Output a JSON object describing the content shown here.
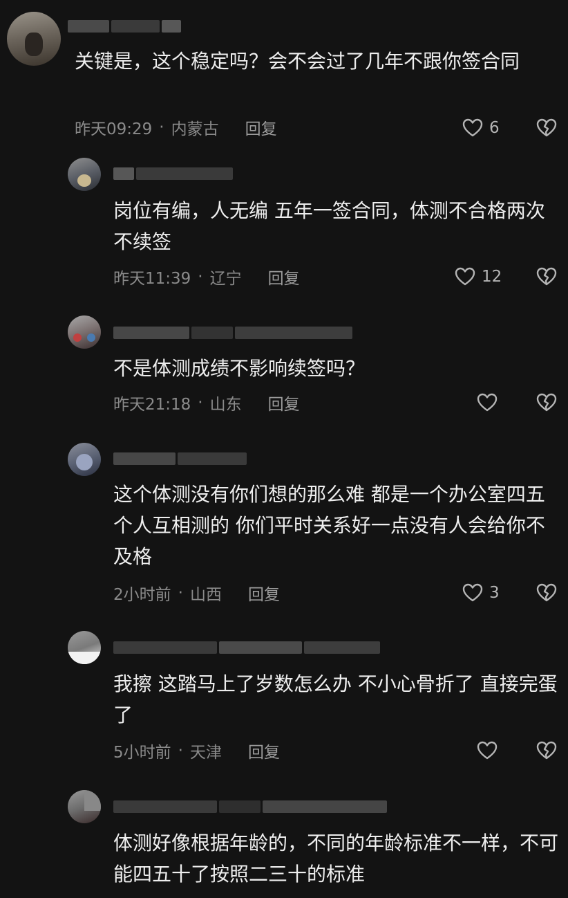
{
  "comments": [
    {
      "text": "关键是，这个稳定吗？会不会过了几年不跟你签合同",
      "time": "昨天09:29",
      "location": "内蒙古",
      "reply_label": "回复",
      "likes": "6"
    },
    {
      "text": "岗位有编，人无编 五年一签合同，体测不合格两次不续签",
      "time": "昨天11:39",
      "location": "辽宁",
      "reply_label": "回复",
      "likes": "12"
    },
    {
      "text": "不是体测成绩不影响续签吗？",
      "time": "昨天21:18",
      "location": "山东",
      "reply_label": "回复",
      "likes": ""
    },
    {
      "text": "这个体测没有你们想的那么难 都是一个办公室四五个人互相测的 你们平时关系好一点没有人会给你不及格",
      "time": "2小时前",
      "location": "山西",
      "reply_label": "回复",
      "likes": "3"
    },
    {
      "text": "我擦 这踏马上了岁数怎么办 不小心骨折了 直接完蛋了",
      "time": "5小时前",
      "location": "天津",
      "reply_label": "回复",
      "likes": ""
    },
    {
      "text": "体测好像根据年龄的，不同的年龄标准不一样，不可能四五十了按照二三十的标准",
      "time": "",
      "location": "",
      "reply_label": "",
      "likes": ""
    }
  ],
  "separator": "·",
  "icons": {
    "like": "heart-outline-icon",
    "dislike": "broken-heart-icon"
  },
  "colors": {
    "background": "#131313",
    "text": "#eeeeee",
    "meta": "#8a8a8a"
  }
}
